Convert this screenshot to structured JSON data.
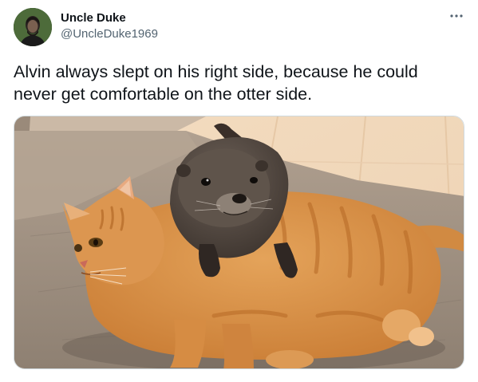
{
  "author": {
    "display_name": "Uncle Duke",
    "handle": "@UncleDuke1969",
    "avatar_icon": "avatar-portrait"
  },
  "menu": {
    "more_icon": "more-horizontal-icon"
  },
  "tweet": {
    "text": "Alvin always slept on his right side, because he could never get comfortable on the otter side."
  },
  "media": {
    "subject": "orange tabby cat lying on a rug with an otter resting on top"
  },
  "colors": {
    "text_primary": "#0f1419",
    "text_secondary": "#536471",
    "border": "#cfd9de"
  }
}
